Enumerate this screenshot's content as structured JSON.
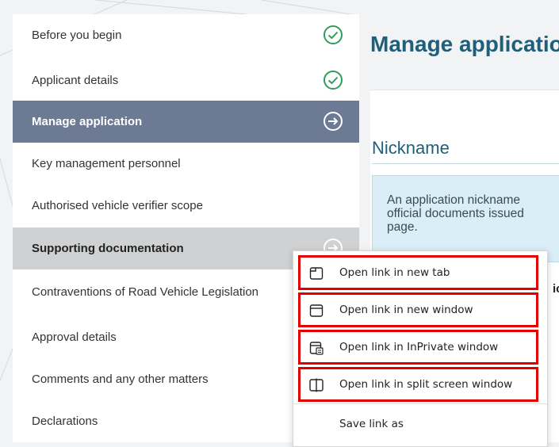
{
  "sidebar": {
    "items": [
      {
        "label": "Before you begin",
        "status": "completed",
        "icon": "check-circle-icon"
      },
      {
        "label": "Applicant details",
        "status": "completed",
        "icon": "check-circle-icon"
      },
      {
        "label": "Manage application",
        "status": "current",
        "icon": "arrow-right-circle-icon"
      },
      {
        "label": "Key management personnel",
        "status": "none",
        "icon": ""
      },
      {
        "label": "Authorised vehicle verifier scope",
        "status": "none",
        "icon": ""
      },
      {
        "label": "Supporting documentation",
        "status": "hovered",
        "icon": "arrow-right-circle-icon"
      },
      {
        "label": "Contraventions of Road Vehicle Legislation",
        "status": "none",
        "icon": ""
      },
      {
        "label": "Approval details",
        "status": "none",
        "icon": ""
      },
      {
        "label": "Comments and any other matters",
        "status": "none",
        "icon": ""
      },
      {
        "label": "Declarations",
        "status": "none",
        "icon": ""
      }
    ]
  },
  "main": {
    "title": "Manage application",
    "section_heading": "Nickname",
    "info_text": "An application nickname\nofficial documents issued\npage.",
    "peek_text": "ic"
  },
  "context_menu": {
    "items": [
      {
        "label": "Open link in new tab",
        "icon": "new-tab-icon",
        "highlighted": true
      },
      {
        "label": "Open link in new window",
        "icon": "new-window-icon",
        "highlighted": true
      },
      {
        "label": "Open link in InPrivate window",
        "icon": "inprivate-window-icon",
        "highlighted": true
      },
      {
        "label": "Open link in split screen window",
        "icon": "split-screen-icon",
        "highlighted": true
      }
    ],
    "save_link_label": "Save link as"
  },
  "colors": {
    "active_nav_bg": "#6c7a94",
    "hover_nav_bg": "#cfd1d3",
    "check_green": "#2e9e5b",
    "title_teal": "#1f5f7a",
    "highlight_red": "#e00000",
    "info_bg": "#d9eef6"
  }
}
